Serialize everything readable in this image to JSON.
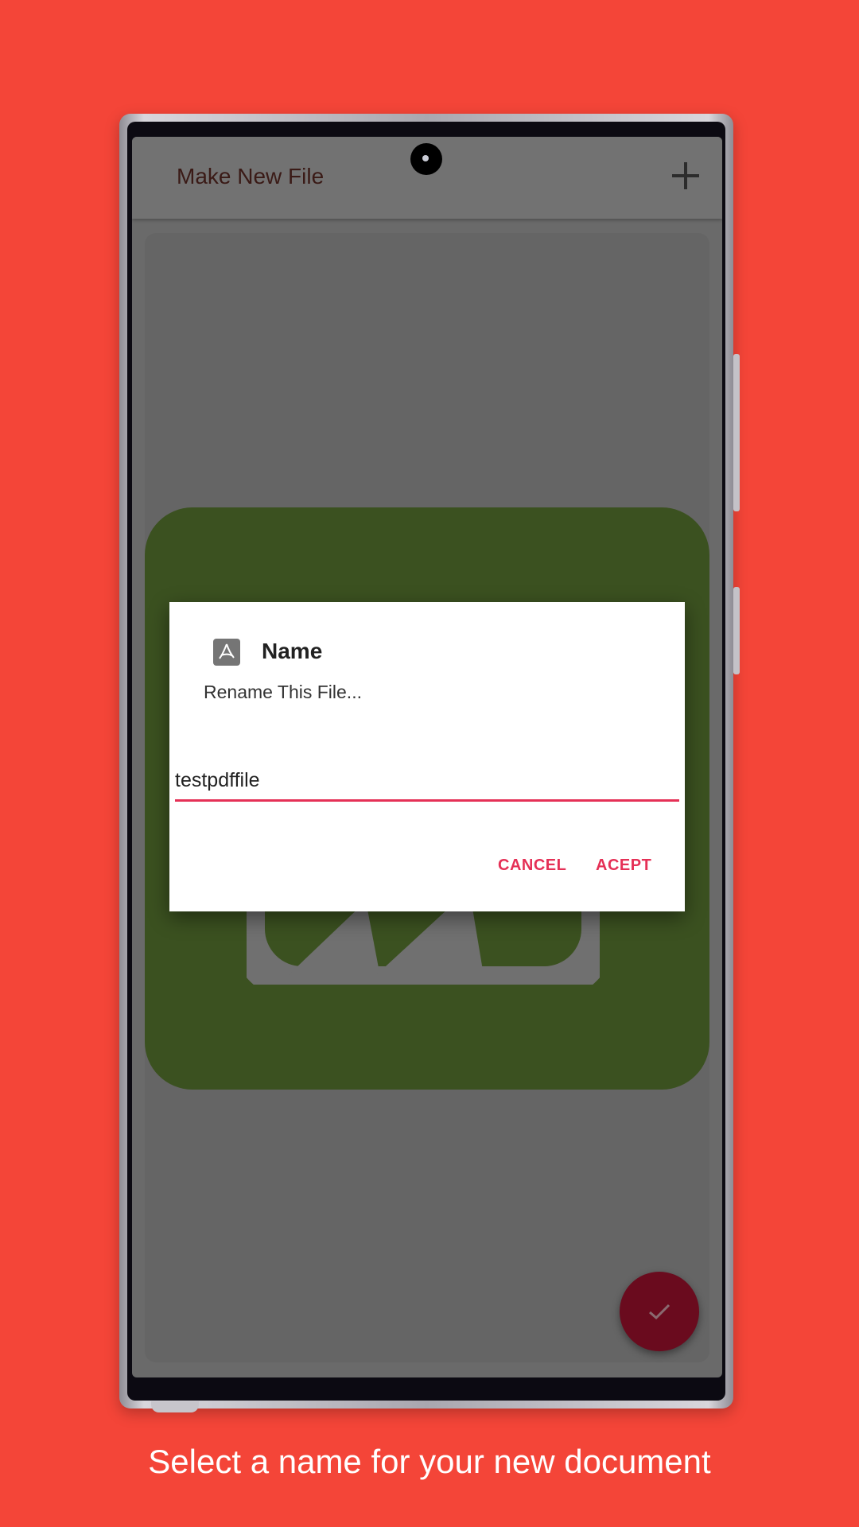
{
  "app": {
    "title": "Make New File"
  },
  "dialog": {
    "title": "Name",
    "message": "Rename This File...",
    "input_value": "testpdffile",
    "cancel_label": "CANCEL",
    "accept_label": "ACEPT",
    "accent_color": "#e53056"
  },
  "caption": "Select a name for your new document",
  "colors": {
    "background": "#f44538",
    "tile": "#3b5120",
    "fab": "#6a0b1e"
  },
  "icons": {
    "appbar_action": "add-icon",
    "dialog_icon": "pdf-icon",
    "fab": "check-icon",
    "tile": "edit-icon"
  }
}
